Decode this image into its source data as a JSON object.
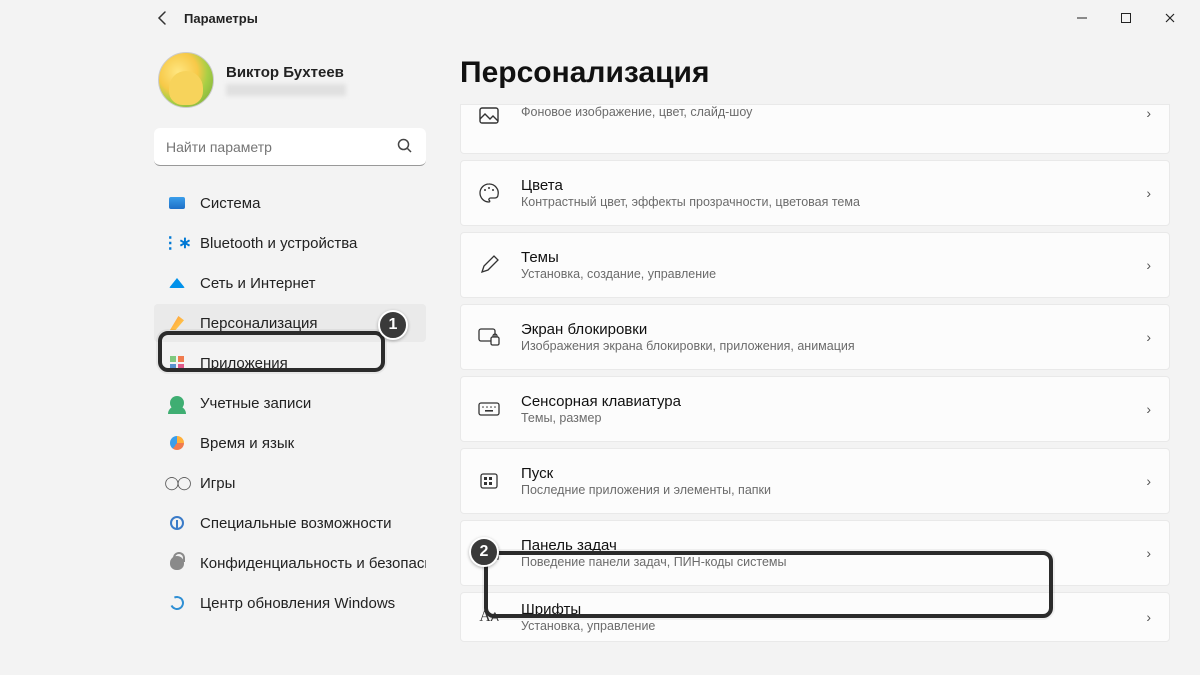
{
  "window": {
    "app_name": "Параметры"
  },
  "profile": {
    "name": "Виктор Бухтеев"
  },
  "search": {
    "placeholder": "Найти параметр"
  },
  "nav": [
    {
      "key": "system",
      "label": "Система"
    },
    {
      "key": "bluetooth",
      "label": "Bluetooth и устройства"
    },
    {
      "key": "network",
      "label": "Сеть и Интернет"
    },
    {
      "key": "personalization",
      "label": "Персонализация"
    },
    {
      "key": "apps",
      "label": "Приложения"
    },
    {
      "key": "accounts",
      "label": "Учетные записи"
    },
    {
      "key": "time",
      "label": "Время и язык"
    },
    {
      "key": "gaming",
      "label": "Игры"
    },
    {
      "key": "accessibility",
      "label": "Специальные возможности"
    },
    {
      "key": "privacy",
      "label": "Конфиденциальность и безопасность"
    },
    {
      "key": "update",
      "label": "Центр обновления Windows"
    }
  ],
  "page": {
    "title": "Персонализация"
  },
  "cards": [
    {
      "key": "background",
      "title": "",
      "sub": "Фоновое изображение, цвет, слайд-шоу"
    },
    {
      "key": "colors",
      "title": "Цвета",
      "sub": "Контрастный цвет, эффекты прозрачности, цветовая тема"
    },
    {
      "key": "themes",
      "title": "Темы",
      "sub": "Установка, создание, управление"
    },
    {
      "key": "lockscreen",
      "title": "Экран блокировки",
      "sub": "Изображения экрана блокировки, приложения, анимация"
    },
    {
      "key": "touchkb",
      "title": "Сенсорная клавиатура",
      "sub": "Темы, размер"
    },
    {
      "key": "start",
      "title": "Пуск",
      "sub": "Последние приложения и элементы, папки"
    },
    {
      "key": "taskbar",
      "title": "Панель задач",
      "sub": "Поведение панели задач, ПИН-коды системы"
    },
    {
      "key": "fonts",
      "title": "Шрифты",
      "sub": "Установка, управление"
    }
  ],
  "annotations": {
    "badge1": "1",
    "badge2": "2"
  }
}
